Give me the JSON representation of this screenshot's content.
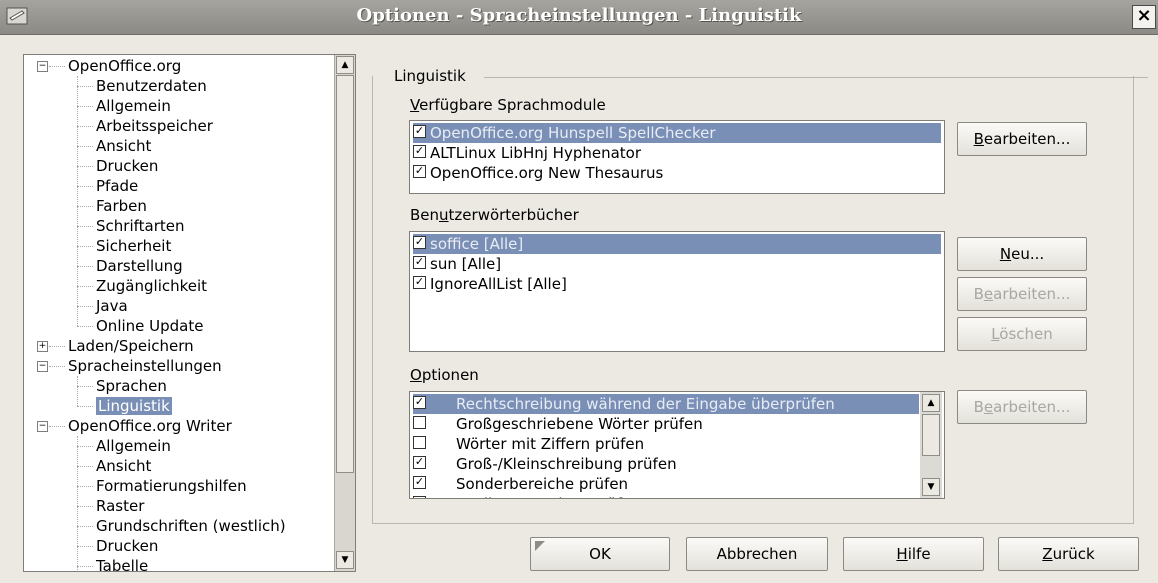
{
  "window": {
    "title": "Optionen - Spracheinstellungen - Linguistik",
    "close_glyph": "×"
  },
  "tree": [
    {
      "label": "OpenOffice.org",
      "level": 0,
      "state": "minus"
    },
    {
      "label": "Benutzerdaten",
      "level": 1
    },
    {
      "label": "Allgemein",
      "level": 1
    },
    {
      "label": "Arbeitsspeicher",
      "level": 1
    },
    {
      "label": "Ansicht",
      "level": 1
    },
    {
      "label": "Drucken",
      "level": 1
    },
    {
      "label": "Pfade",
      "level": 1
    },
    {
      "label": "Farben",
      "level": 1
    },
    {
      "label": "Schriftarten",
      "level": 1
    },
    {
      "label": "Sicherheit",
      "level": 1
    },
    {
      "label": "Darstellung",
      "level": 1
    },
    {
      "label": "Zugänglichkeit",
      "level": 1
    },
    {
      "label": "Java",
      "level": 1
    },
    {
      "label": "Online Update",
      "level": 1
    },
    {
      "label": "Laden/Speichern",
      "level": 0,
      "state": "plus"
    },
    {
      "label": "Spracheinstellungen",
      "level": 0,
      "state": "minus"
    },
    {
      "label": "Sprachen",
      "level": 1
    },
    {
      "label": "Linguistik",
      "level": 1,
      "selected": true
    },
    {
      "label": "OpenOffice.org Writer",
      "level": 0,
      "state": "minus"
    },
    {
      "label": "Allgemein",
      "level": 1
    },
    {
      "label": "Ansicht",
      "level": 1
    },
    {
      "label": "Formatierungshilfen",
      "level": 1
    },
    {
      "label": "Raster",
      "level": 1
    },
    {
      "label": "Grundschriften (westlich)",
      "level": 1
    },
    {
      "label": "Drucken",
      "level": 1
    },
    {
      "label": "Tabelle",
      "level": 1
    }
  ],
  "linguistik": {
    "group_label": "Linguistik",
    "modules_label": "Verfügbare Sprachmodule",
    "modules": [
      {
        "label": "OpenOffice.org Hunspell SpellChecker",
        "checked": true,
        "selected": true
      },
      {
        "label": "ALTLinux LibHnj Hyphenator",
        "checked": true
      },
      {
        "label": "OpenOffice.org New Thesaurus",
        "checked": true
      }
    ],
    "modules_edit": "Bearbeiten...",
    "dicts_label": "Benutzerwörterbücher",
    "dicts": [
      {
        "label": "soffice [Alle]",
        "checked": true,
        "selected": true
      },
      {
        "label": "sun [Alle]",
        "checked": true
      },
      {
        "label": "IgnoreAllList [Alle]",
        "checked": true
      }
    ],
    "dicts_new": "Neu...",
    "dicts_edit": "Bearbeiten...",
    "dicts_delete": "Löschen",
    "options_label": "Optionen",
    "options": [
      {
        "label": "Rechtschreibung während der Eingabe überprüfen",
        "checked": true,
        "selected": true
      },
      {
        "label": "Großgeschriebene Wörter prüfen",
        "checked": false
      },
      {
        "label": "Wörter mit Ziffern prüfen",
        "checked": false
      },
      {
        "label": "Groß-/Kleinschreibung prüfen",
        "checked": true
      },
      {
        "label": "Sonderbereiche prüfen",
        "checked": true
      },
      {
        "label": "In allen Sprachen prüfen",
        "checked": false
      }
    ],
    "options_edit": "Bearbeiten..."
  },
  "buttons": {
    "ok": "OK",
    "cancel": "Abbrechen",
    "help": "Hilfe",
    "back": "Zurück"
  },
  "check_glyph": "✓"
}
